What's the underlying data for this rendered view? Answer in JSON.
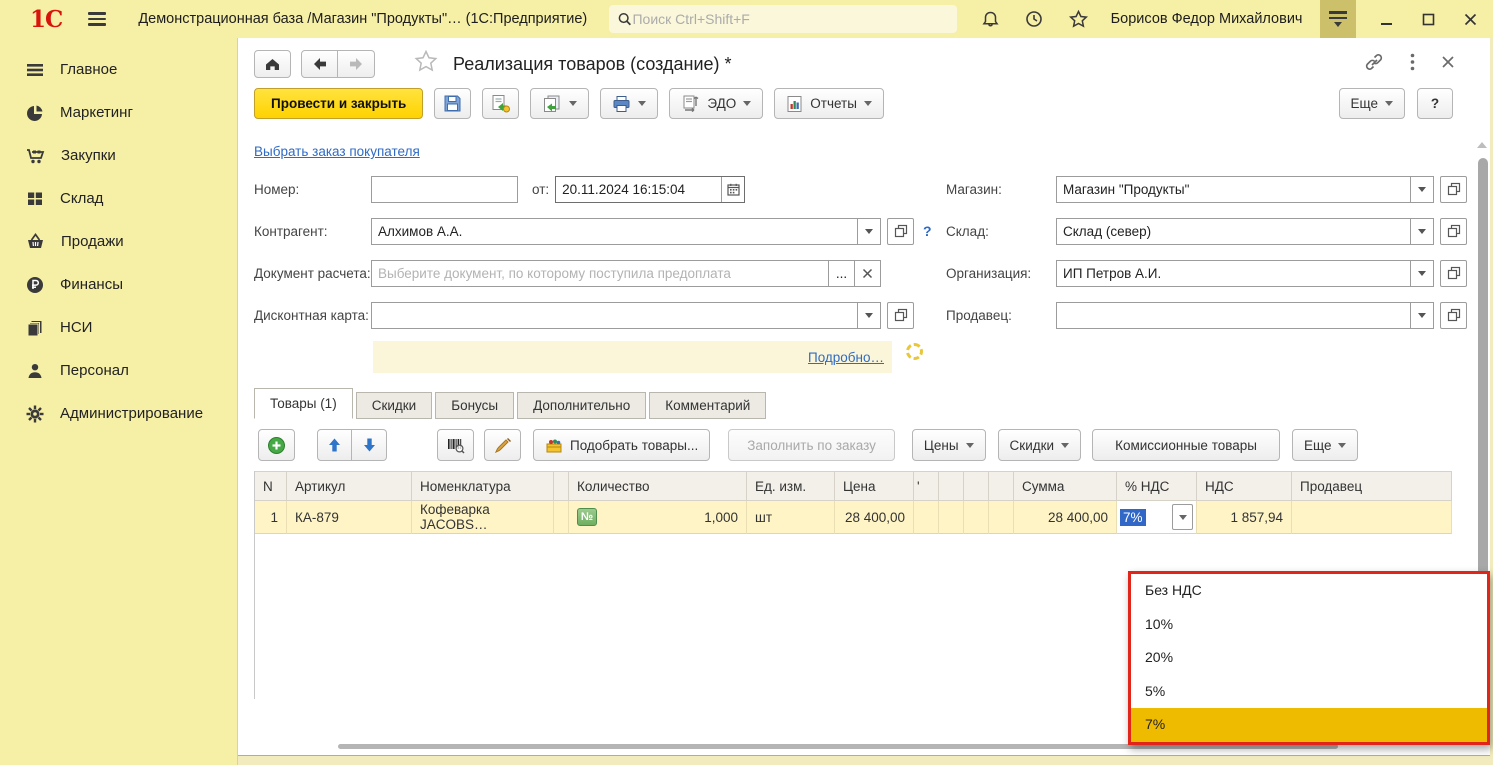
{
  "colors": {
    "sidebar_bg": "#F6EFA6",
    "primary_button": "#FFD400",
    "row_highlight": "#FFF4C6",
    "dropdown_highlight": "#EFBB00",
    "annotation_border": "#E2251B",
    "link_blue": "#2F6BC4",
    "selection_blue": "#3168C8"
  },
  "topbar": {
    "logo": "1С",
    "title": "Демонстрационная база /Магазин \"Продукты\"…  (1С:Предприятие)",
    "search_placeholder": "Поиск Ctrl+Shift+F",
    "user": "Борисов Федор Михайлович"
  },
  "sidebar": {
    "items": [
      {
        "label": "Главное"
      },
      {
        "label": "Маркетинг"
      },
      {
        "label": "Закупки"
      },
      {
        "label": "Склад"
      },
      {
        "label": "Продажи"
      },
      {
        "label": "Финансы"
      },
      {
        "label": "НСИ"
      },
      {
        "label": "Персонал"
      },
      {
        "label": "Администрирование"
      }
    ]
  },
  "page": {
    "title": "Реализация товаров (создание) *",
    "more": "Еще",
    "help": "?"
  },
  "cmd": {
    "post_close": "Провести и закрыть",
    "edo": "ЭДО",
    "reports": "Отчеты"
  },
  "form": {
    "order_link": "Выбрать заказ покупателя",
    "number_label": "Номер:",
    "date_label": "от:",
    "date_value": "20.11.2024 16:15:04",
    "contragent_label": "Контрагент:",
    "contragent_value": "Алхимов А.А.",
    "help": "?",
    "settlement_label": "Документ расчета:",
    "settlement_placeholder": "Выберите документ, по которому поступила предоплата",
    "dots": "...",
    "discount_label": "Дисконтная карта:",
    "store_label": "Магазин:",
    "store_value": "Магазин \"Продукты\"",
    "warehouse_label": "Склад:",
    "warehouse_value": "Склад (север)",
    "org_label": "Организация:",
    "org_value": "ИП Петров А.И.",
    "seller_label": "Продавец:",
    "details_link": "Подробно…"
  },
  "tabs": [
    {
      "label": "Товары (1)"
    },
    {
      "label": "Скидки"
    },
    {
      "label": "Бонусы"
    },
    {
      "label": "Дополнительно"
    },
    {
      "label": "Комментарий"
    }
  ],
  "ttb": {
    "pick": "Подобрать товары...",
    "fill": "Заполнить по заказу",
    "prices": "Цены",
    "discounts": "Скидки",
    "commission": "Комиссионные товары",
    "more": "Еще"
  },
  "table": {
    "columns": [
      "N",
      "Артикул",
      "Номенклатура",
      "",
      "Количество",
      "Ед. изм.",
      "Цена",
      "'",
      "",
      "",
      "",
      "Сумма",
      "% НДС",
      "НДС",
      "Продавец"
    ],
    "rows": [
      {
        "n": "1",
        "article": "КА-879",
        "name": "Кофеварка JACOBS…",
        "qty_badge": "№",
        "qty": "1,000",
        "unit": "шт",
        "price": "28 400,00",
        "sum": "28 400,00",
        "vat_rate": "7%",
        "vat_sum": "1 857,94",
        "seller": ""
      }
    ]
  },
  "vat": {
    "options": [
      "Без НДС",
      "10%",
      "20%",
      "5%",
      "7%"
    ],
    "selected": "7%"
  }
}
